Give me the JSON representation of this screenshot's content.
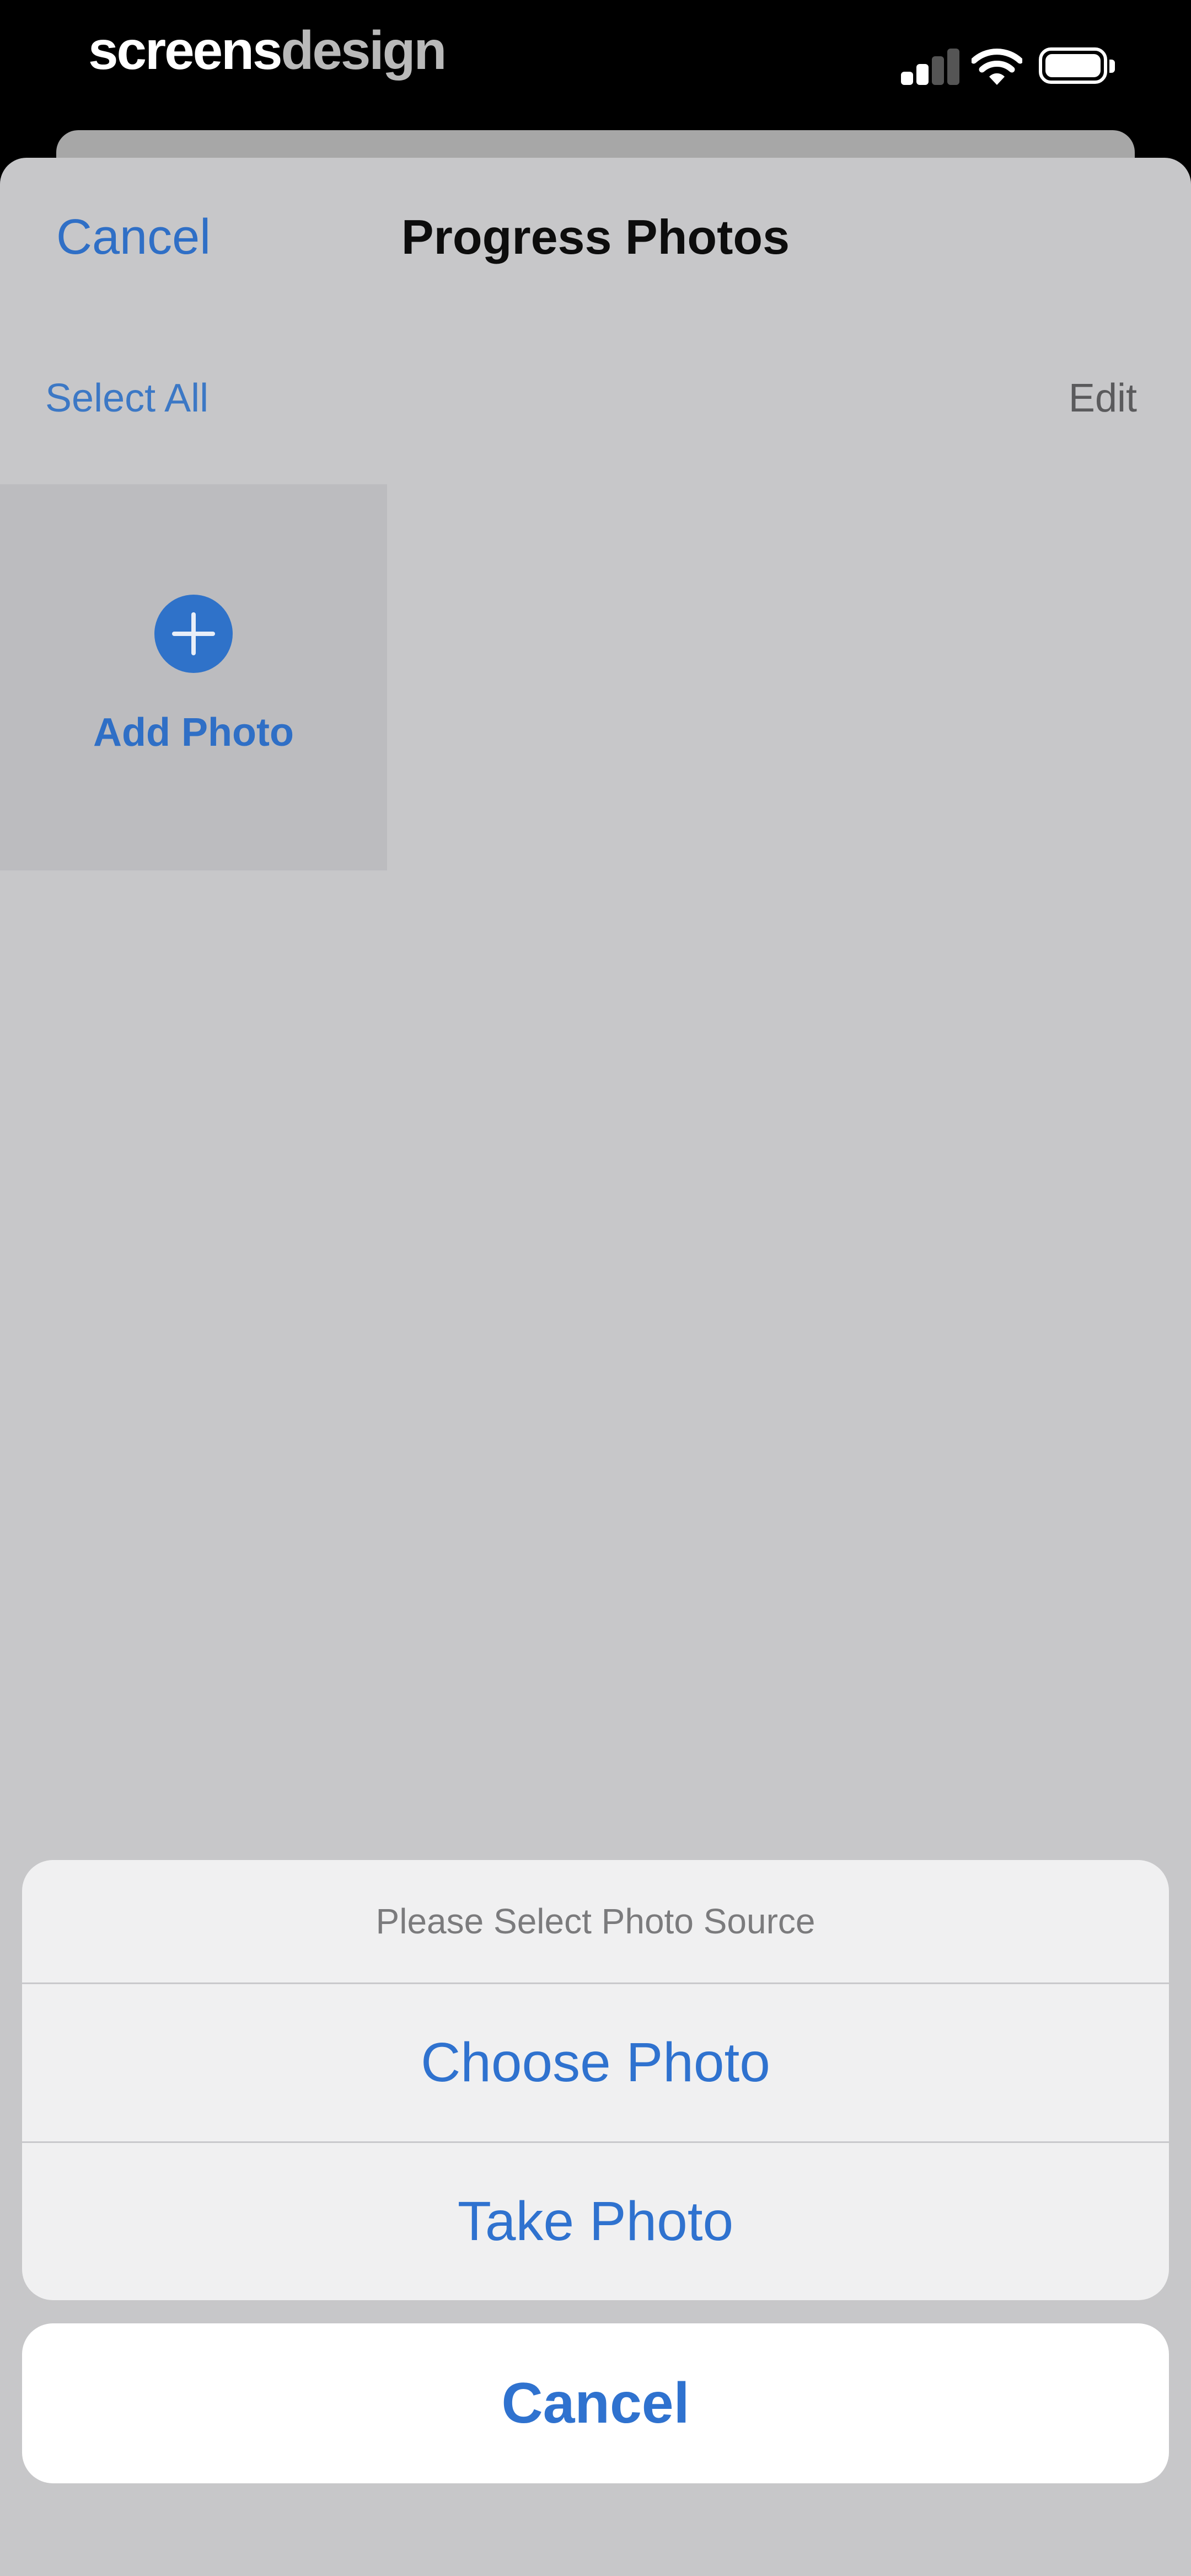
{
  "status_bar": {
    "brand_part1": "screens",
    "brand_part2": "design",
    "signal_icon": "cellular-signal-icon",
    "wifi_icon": "wifi-icon",
    "battery_icon": "battery-icon"
  },
  "nav": {
    "cancel": "Cancel",
    "title": "Progress Photos"
  },
  "toolbar": {
    "select_all": "Select All",
    "edit": "Edit"
  },
  "grid": {
    "add_photo": "Add Photo",
    "add_icon": "plus-circle-icon"
  },
  "action_sheet": {
    "header": "Please Select Photo Source",
    "options": [
      "Choose Photo",
      "Take Photo"
    ],
    "cancel": "Cancel"
  },
  "colors": {
    "accent": "#2f72cf",
    "dimmed_background": "#c7c7c9",
    "sheet_surface": "#f0f0f1"
  }
}
